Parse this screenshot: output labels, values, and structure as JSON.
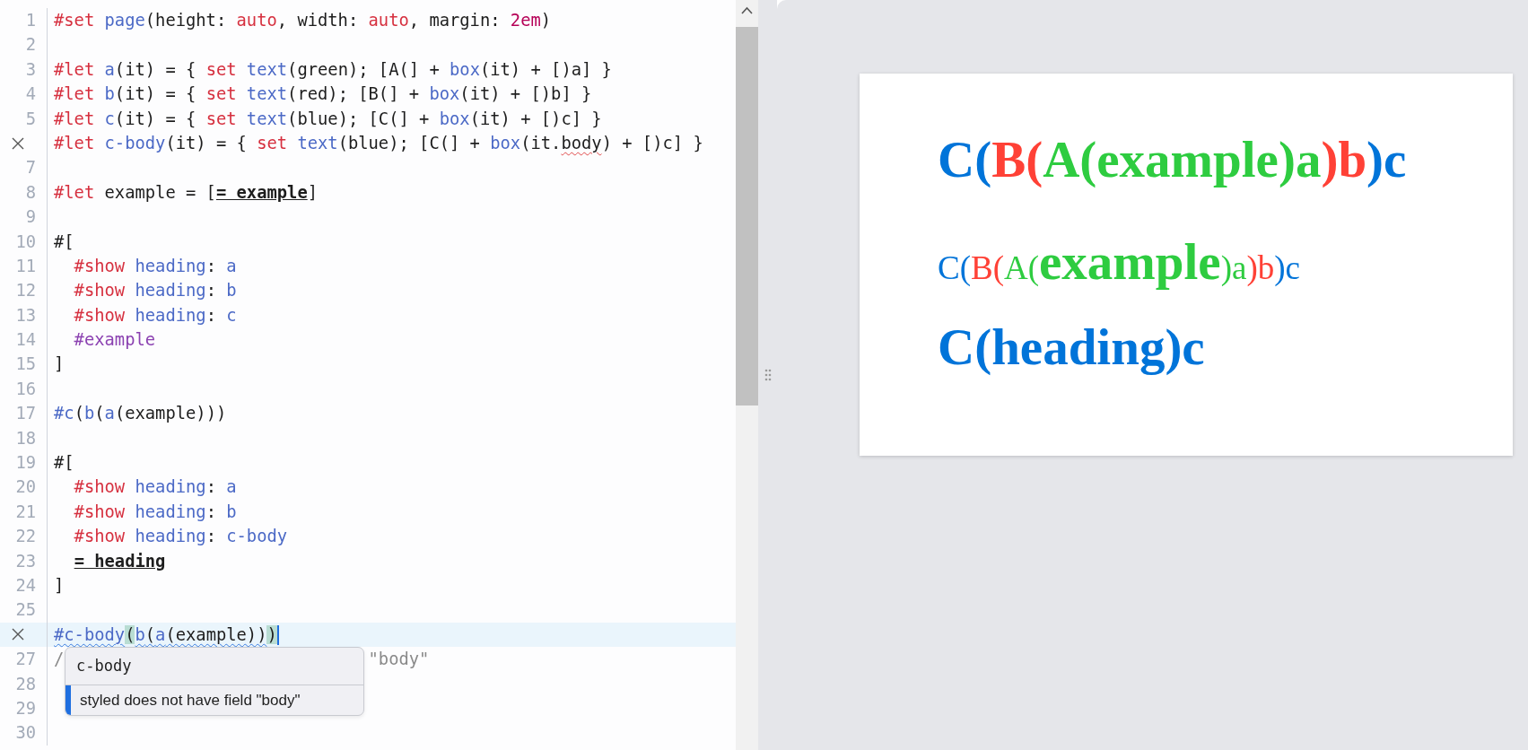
{
  "editor": {
    "lines": [
      {
        "number": "1",
        "tokens": [
          {
            "text": "#set ",
            "kind": "keyword"
          },
          {
            "text": "page",
            "kind": "func"
          },
          {
            "text": "(height: ",
            "kind": "plain"
          },
          {
            "text": "auto",
            "kind": "keyword"
          },
          {
            "text": ", width: ",
            "kind": "plain"
          },
          {
            "text": "auto",
            "kind": "keyword"
          },
          {
            "text": ", margin: ",
            "kind": "plain"
          },
          {
            "text": "2em",
            "kind": "number"
          },
          {
            "text": ")",
            "kind": "plain"
          }
        ]
      },
      {
        "number": "2"
      },
      {
        "number": "3",
        "tokens": [
          {
            "text": "#let ",
            "kind": "keyword"
          },
          {
            "text": "a",
            "kind": "func"
          },
          {
            "text": "(it) = { ",
            "kind": "plain"
          },
          {
            "text": "set ",
            "kind": "keyword"
          },
          {
            "text": "text",
            "kind": "func"
          },
          {
            "text": "(green); [A(] + ",
            "kind": "plain"
          },
          {
            "text": "box",
            "kind": "func"
          },
          {
            "text": "(it) + [)a] }",
            "kind": "plain"
          }
        ]
      },
      {
        "number": "4",
        "tokens": [
          {
            "text": "#let ",
            "kind": "keyword"
          },
          {
            "text": "b",
            "kind": "func"
          },
          {
            "text": "(it) = { ",
            "kind": "plain"
          },
          {
            "text": "set ",
            "kind": "keyword"
          },
          {
            "text": "text",
            "kind": "func"
          },
          {
            "text": "(red); [B(] + ",
            "kind": "plain"
          },
          {
            "text": "box",
            "kind": "func"
          },
          {
            "text": "(it) + [)b] }",
            "kind": "plain"
          }
        ]
      },
      {
        "number": "5",
        "tokens": [
          {
            "text": "#let ",
            "kind": "keyword"
          },
          {
            "text": "c",
            "kind": "func"
          },
          {
            "text": "(it) = { ",
            "kind": "plain"
          },
          {
            "text": "set ",
            "kind": "keyword"
          },
          {
            "text": "text",
            "kind": "func"
          },
          {
            "text": "(blue); [C(] + ",
            "kind": "plain"
          },
          {
            "text": "box",
            "kind": "func"
          },
          {
            "text": "(it) + [)c] }",
            "kind": "plain"
          }
        ]
      },
      {
        "error": true,
        "tokens": [
          {
            "text": "#let ",
            "kind": "keyword"
          },
          {
            "text": "c-body",
            "kind": "func"
          },
          {
            "text": "(it) = { ",
            "kind": "plain"
          },
          {
            "text": "set ",
            "kind": "keyword"
          },
          {
            "text": "text",
            "kind": "func"
          },
          {
            "text": "(blue); [C(] + ",
            "kind": "plain"
          },
          {
            "text": "box",
            "kind": "func"
          },
          {
            "text": "(it.",
            "kind": "plain"
          },
          {
            "text": "body",
            "kind": "plain",
            "error_squiggle": true
          },
          {
            "text": ") + [)c] }",
            "kind": "plain"
          }
        ]
      },
      {
        "number": "7"
      },
      {
        "number": "8",
        "tokens": [
          {
            "text": "#let ",
            "kind": "keyword"
          },
          {
            "text": "example = [",
            "kind": "plain"
          },
          {
            "text": "= example",
            "kind": "heading"
          },
          {
            "text": "]",
            "kind": "plain"
          }
        ]
      },
      {
        "number": "9"
      },
      {
        "number": "10",
        "tokens": [
          {
            "text": "#[",
            "kind": "plain"
          }
        ]
      },
      {
        "number": "11",
        "tokens": [
          {
            "text": "  #show ",
            "kind": "keyword"
          },
          {
            "text": "heading",
            "kind": "func"
          },
          {
            "text": ": ",
            "kind": "plain"
          },
          {
            "text": "a",
            "kind": "func"
          }
        ]
      },
      {
        "number": "12",
        "tokens": [
          {
            "text": "  #show ",
            "kind": "keyword"
          },
          {
            "text": "heading",
            "kind": "func"
          },
          {
            "text": ": ",
            "kind": "plain"
          },
          {
            "text": "b",
            "kind": "func"
          }
        ]
      },
      {
        "number": "13",
        "tokens": [
          {
            "text": "  #show ",
            "kind": "keyword"
          },
          {
            "text": "heading",
            "kind": "func"
          },
          {
            "text": ": ",
            "kind": "plain"
          },
          {
            "text": "c",
            "kind": "func"
          }
        ]
      },
      {
        "number": "14",
        "tokens": [
          {
            "text": "  #example",
            "kind": "var"
          }
        ]
      },
      {
        "number": "15",
        "tokens": [
          {
            "text": "]",
            "kind": "plain"
          }
        ]
      },
      {
        "number": "16"
      },
      {
        "number": "17",
        "tokens": [
          {
            "text": "#c",
            "kind": "func"
          },
          {
            "text": "(",
            "kind": "plain"
          },
          {
            "text": "b",
            "kind": "func"
          },
          {
            "text": "(",
            "kind": "plain"
          },
          {
            "text": "a",
            "kind": "func"
          },
          {
            "text": "(example)))",
            "kind": "plain"
          }
        ]
      },
      {
        "number": "18"
      },
      {
        "number": "19",
        "tokens": [
          {
            "text": "#[",
            "kind": "plain"
          }
        ]
      },
      {
        "number": "20",
        "tokens": [
          {
            "text": "  #show ",
            "kind": "keyword"
          },
          {
            "text": "heading",
            "kind": "func"
          },
          {
            "text": ": ",
            "kind": "plain"
          },
          {
            "text": "a",
            "kind": "func"
          }
        ]
      },
      {
        "number": "21",
        "tokens": [
          {
            "text": "  #show ",
            "kind": "keyword"
          },
          {
            "text": "heading",
            "kind": "func"
          },
          {
            "text": ": ",
            "kind": "plain"
          },
          {
            "text": "b",
            "kind": "func"
          }
        ]
      },
      {
        "number": "22",
        "tokens": [
          {
            "text": "  #show ",
            "kind": "keyword"
          },
          {
            "text": "heading",
            "kind": "func"
          },
          {
            "text": ": ",
            "kind": "plain"
          },
          {
            "text": "c-body",
            "kind": "func"
          }
        ]
      },
      {
        "number": "23",
        "tokens": [
          {
            "text": "  = heading",
            "kind": "heading"
          }
        ]
      },
      {
        "number": "24",
        "tokens": [
          {
            "text": "]",
            "kind": "plain"
          }
        ]
      },
      {
        "number": "25"
      },
      {
        "error": true,
        "active": true,
        "cursor": true,
        "tokens": [
          {
            "text": "#c-body",
            "kind": "func",
            "info_squiggle": true
          },
          {
            "text": "(",
            "kind": "plain",
            "matched": true
          },
          {
            "text": "b",
            "kind": "func",
            "info_squiggle": true
          },
          {
            "text": "(",
            "kind": "plain",
            "info_squiggle": true
          },
          {
            "text": "a",
            "kind": "func",
            "info_squiggle": true
          },
          {
            "text": "(example))",
            "kind": "plain",
            "info_squiggle": true
          },
          {
            "text": ")",
            "kind": "plain",
            "matched": true
          }
        ]
      },
      {
        "number": "27",
        "tokens": [
          {
            "text": "/",
            "kind": "comment"
          },
          {
            "text": "\"body\"",
            "kind": "comment-tail"
          }
        ]
      },
      {
        "number": "28"
      },
      {
        "number": "29"
      },
      {
        "number": "30"
      }
    ],
    "tooltip": {
      "title": "c-body",
      "message": "styled does not have field \"body\""
    }
  },
  "preview": {
    "lines": [
      {
        "kind": "heading",
        "segments": [
          {
            "text": "C(",
            "color": "#0074d9"
          },
          {
            "text": "B(",
            "color": "#ff4136"
          },
          {
            "text": "A(example)a",
            "color": "#2ecc40"
          },
          {
            "text": ")b",
            "color": "#ff4136"
          },
          {
            "text": ")c",
            "color": "#0074d9"
          }
        ]
      },
      {
        "kind": "plain",
        "segments": [
          {
            "text": "C(",
            "color": "#0074d9"
          },
          {
            "text": "B(",
            "color": "#ff4136"
          },
          {
            "text": "A(",
            "color": "#2ecc40"
          },
          {
            "text": "example",
            "color": "#2ecc40",
            "kind": "heading"
          },
          {
            "text": ")a",
            "color": "#2ecc40"
          },
          {
            "text": ")b",
            "color": "#ff4136"
          },
          {
            "text": ")c",
            "color": "#0074d9"
          }
        ]
      },
      {
        "kind": "heading",
        "segments": [
          {
            "text": "C(heading)c",
            "color": "#0074d9"
          }
        ]
      }
    ]
  }
}
